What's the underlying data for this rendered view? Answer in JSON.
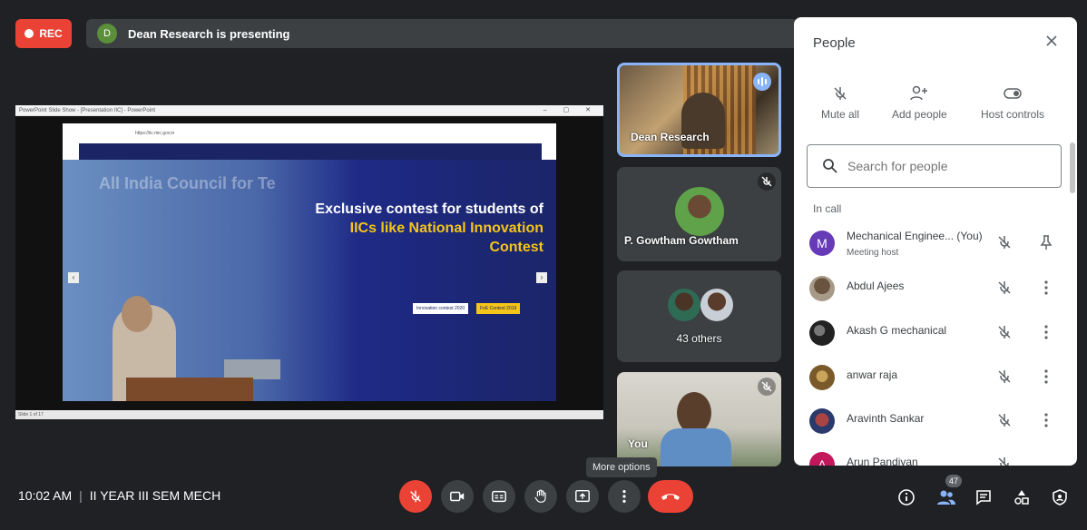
{
  "topbar": {
    "rec_label": "REC",
    "presenter_initial": "D",
    "presenting_text": "Dean Research is presenting"
  },
  "shared_screen": {
    "window_title": "PowerPoint Slide Show - [Presentation IIC] - PowerPoint",
    "slide_status": "Slide 1 of 17",
    "browser_url": "https://iic.mic.gov.in",
    "headline_line1": "Exclusive contest for students of",
    "headline_line2": "IICs like National Innovation",
    "headline_line3": "Contest",
    "button_1": "Innovation contest 2020",
    "button_2": "FoE Contest 2019",
    "banner_text": "All India Council for Te"
  },
  "tiles": [
    {
      "name": "Dean Research"
    },
    {
      "name": "P. Gowtham Gowtham"
    },
    {
      "name": "43 others"
    },
    {
      "name": "You"
    }
  ],
  "people_panel": {
    "title": "People",
    "actions": [
      {
        "label": "Mute all",
        "icon": "mic-off-icon"
      },
      {
        "label": "Add people",
        "icon": "person-add-icon"
      },
      {
        "label": "Host controls",
        "icon": "toggle-icon"
      }
    ],
    "search_placeholder": "Search for people",
    "section_label": "In call",
    "participants": [
      {
        "name": "Mechanical Enginee... (You)",
        "role": "Meeting host",
        "initial": "M",
        "color": "#673ab7"
      },
      {
        "name": "Abdul Ajees",
        "role": "",
        "initial": "",
        "color": "#7a6a55"
      },
      {
        "name": "Akash G mechanical",
        "role": "",
        "initial": "",
        "color": "#3a3a3a"
      },
      {
        "name": "anwar raja",
        "role": "",
        "initial": "",
        "color": "#b48a3a"
      },
      {
        "name": "Aravinth Sankar",
        "role": "",
        "initial": "",
        "color": "#8a2a3a"
      },
      {
        "name": "Arun Pandiyan",
        "role": "",
        "initial": "A",
        "color": "#c2185b"
      }
    ]
  },
  "bottombar": {
    "time": "10:02 AM",
    "meeting_name": "II YEAR III SEM MECH",
    "tooltip": "More options",
    "participant_count": "47"
  }
}
